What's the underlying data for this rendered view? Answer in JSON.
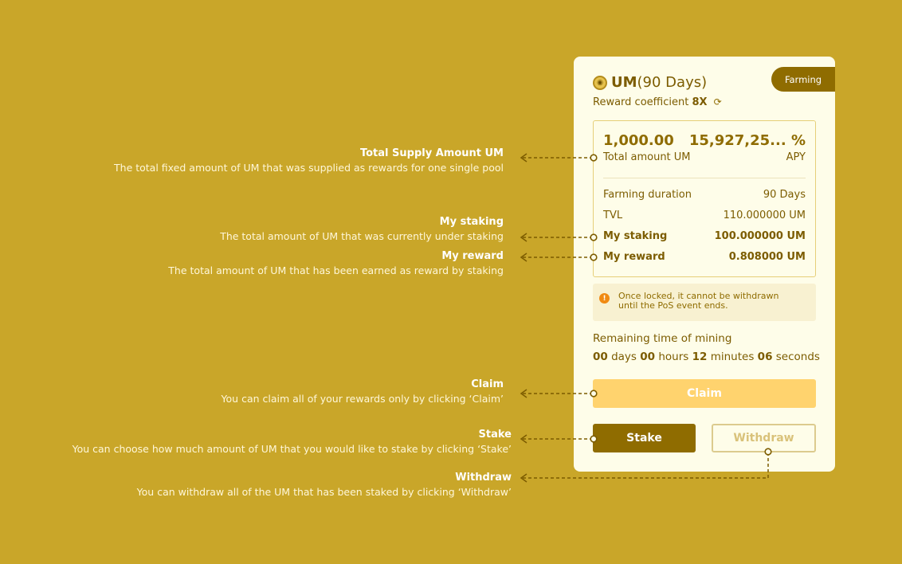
{
  "card": {
    "badge": "Farming",
    "token": "UM",
    "duration_title": "(90 Days)",
    "coef_label": "Reward coefficient",
    "coef_value": "8X",
    "total_amount_value": "1,000.00",
    "total_amount_label": "Total amount UM",
    "apy_value": "15,927,25... %",
    "apy_label": "APY",
    "rows": [
      {
        "label": "Farming duration",
        "value": "90 Days"
      },
      {
        "label": "TVL",
        "value": "110.000000 UM"
      },
      {
        "label": "My staking",
        "value": "100.000000 UM"
      },
      {
        "label": "My reward",
        "value": "0.808000 UM"
      }
    ],
    "notice_line1": "Once locked, it cannot be withdrawn",
    "notice_line2": "until the PoS event ends.",
    "remaining_label": "Remaining time of mining",
    "remaining": {
      "days_num": "00",
      "days_word": "days",
      "hours_num": "00",
      "hours_word": "hours",
      "minutes_num": "12",
      "minutes_word": "minutes",
      "seconds_num": "06",
      "seconds_word": "seconds"
    },
    "claim_label": "Claim",
    "stake_label": "Stake",
    "withdraw_label": "Withdraw"
  },
  "annotations": [
    {
      "title": "Total Supply Amount UM",
      "desc": "The total fixed amount of UM that was supplied as rewards for one single pool"
    },
    {
      "title": "My staking",
      "desc": "The total amount of UM that was currently under staking"
    },
    {
      "title": "My reward",
      "desc": "The total amount of UM that has been earned as reward by staking"
    },
    {
      "title": "Claim",
      "desc": "You can claim all of your rewards only by clicking ‘Claim’"
    },
    {
      "title": "Stake",
      "desc": "You can choose how much amount of UM that you would like to stake by clicking ‘Stake’"
    },
    {
      "title": "Withdraw",
      "desc": "You can withdraw all of the UM that has been staked by clicking ‘Withdraw’"
    }
  ],
  "colors": {
    "background": "#c9a629",
    "card": "#fefde9",
    "accent": "#8f6c00",
    "claim": "#ffd36e"
  }
}
